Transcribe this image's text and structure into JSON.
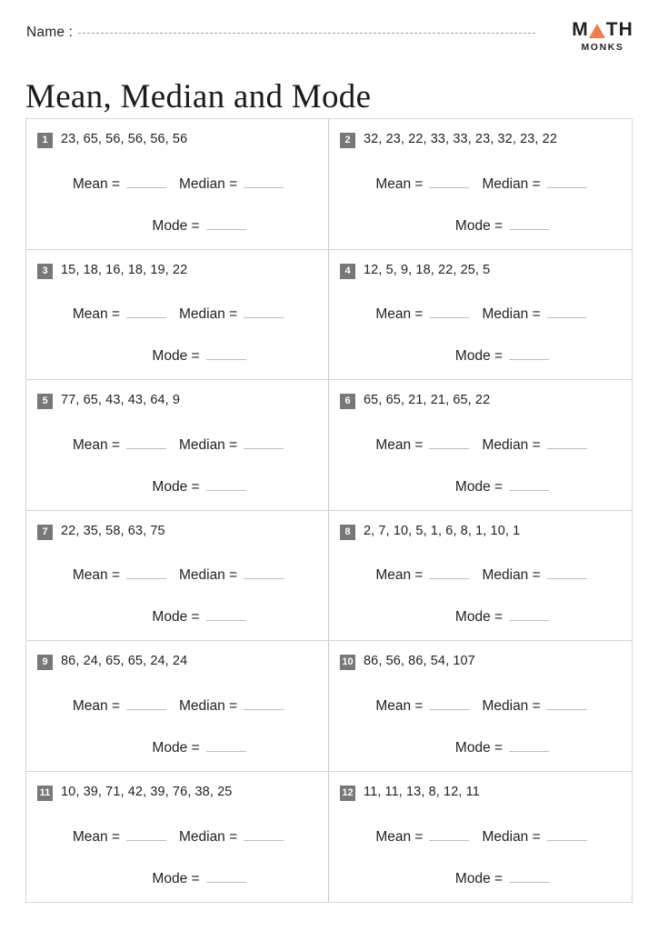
{
  "header": {
    "name_label": "Name :",
    "title": "Mean, Median and Mode",
    "logo": {
      "part1": "M",
      "triangle_icon": "orange-triangle",
      "part2": "TH",
      "subtitle": "MONKS",
      "accent_color": "#ef7c4e"
    }
  },
  "labels": {
    "mean": "Mean =",
    "median": "Median =",
    "mode": "Mode ="
  },
  "problems": [
    {
      "number": "1",
      "data": "23, 65, 56, 56, 56, 56"
    },
    {
      "number": "2",
      "data": "32, 23, 22, 33, 33, 23, 32, 23, 22"
    },
    {
      "number": "3",
      "data": "15, 18, 16, 18, 19, 22"
    },
    {
      "number": "4",
      "data": "12, 5, 9, 18, 22, 25, 5"
    },
    {
      "number": "5",
      "data": "77, 65, 43, 43, 64, 9"
    },
    {
      "number": "6",
      "data": "65, 65, 21, 21, 65, 22"
    },
    {
      "number": "7",
      "data": "22, 35, 58, 63, 75"
    },
    {
      "number": "8",
      "data": "2, 7, 10, 5, 1, 6, 8, 1, 10, 1"
    },
    {
      "number": "9",
      "data": "86, 24, 65, 65, 24, 24"
    },
    {
      "number": "10",
      "data": "86, 56, 86, 54, 107"
    },
    {
      "number": "11",
      "data": "10, 39, 71, 42, 39, 76, 38, 25"
    },
    {
      "number": "12",
      "data": "11, 11, 13, 8, 12, 11"
    }
  ],
  "colors": {
    "badge_bg": "#787878",
    "grid_border": "#d6d6d6",
    "blank_line": "#bdbdbd",
    "text": "#231f20"
  }
}
